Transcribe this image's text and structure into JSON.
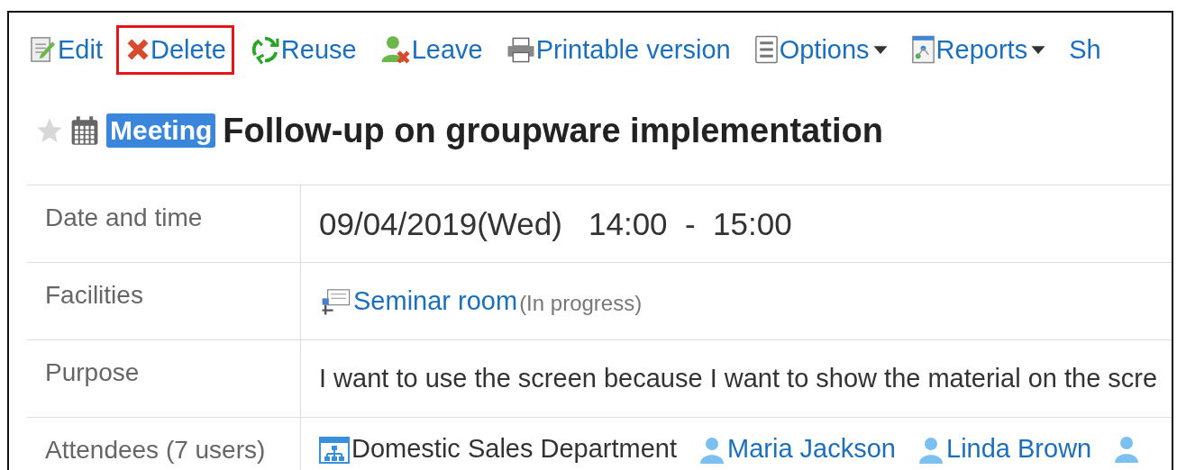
{
  "toolbar": [
    {
      "kind": "edit",
      "label": "Edit",
      "highlighted": false,
      "dropdown": false
    },
    {
      "kind": "delete",
      "label": "Delete",
      "highlighted": true,
      "dropdown": false
    },
    {
      "kind": "reuse",
      "label": "Reuse",
      "highlighted": false,
      "dropdown": false
    },
    {
      "kind": "leave",
      "label": "Leave",
      "highlighted": false,
      "dropdown": false
    },
    {
      "kind": "print",
      "label": "Printable version",
      "highlighted": false,
      "dropdown": false
    },
    {
      "kind": "options",
      "label": "Options",
      "highlighted": false,
      "dropdown": true
    },
    {
      "kind": "reports",
      "label": "Reports",
      "highlighted": false,
      "dropdown": true
    },
    {
      "kind": "plain",
      "label": "Sh",
      "highlighted": false,
      "dropdown": false
    }
  ],
  "event": {
    "starred": false,
    "tag": "Meeting",
    "title": "Follow-up on groupware implementation"
  },
  "details": [
    {
      "kind": "datetime",
      "label": "Date and time",
      "date": "09/04/2019(Wed)",
      "start": "14:00",
      "separator": "-",
      "end": "15:00"
    },
    {
      "kind": "facility",
      "label": "Facilities",
      "link": "Seminar room",
      "status": "(In progress)"
    },
    {
      "kind": "text",
      "label": "Purpose",
      "text": "I want to use the screen because I want to show the material on the scre"
    },
    {
      "kind": "attendees",
      "label": "Attendees (7 users)",
      "entries": [
        {
          "kind": "group",
          "name": "Domestic Sales Department"
        },
        {
          "kind": "user",
          "name": "Maria Jackson"
        },
        {
          "kind": "user",
          "name": "Linda Brown"
        },
        {
          "kind": "user"
        }
      ]
    }
  ]
}
